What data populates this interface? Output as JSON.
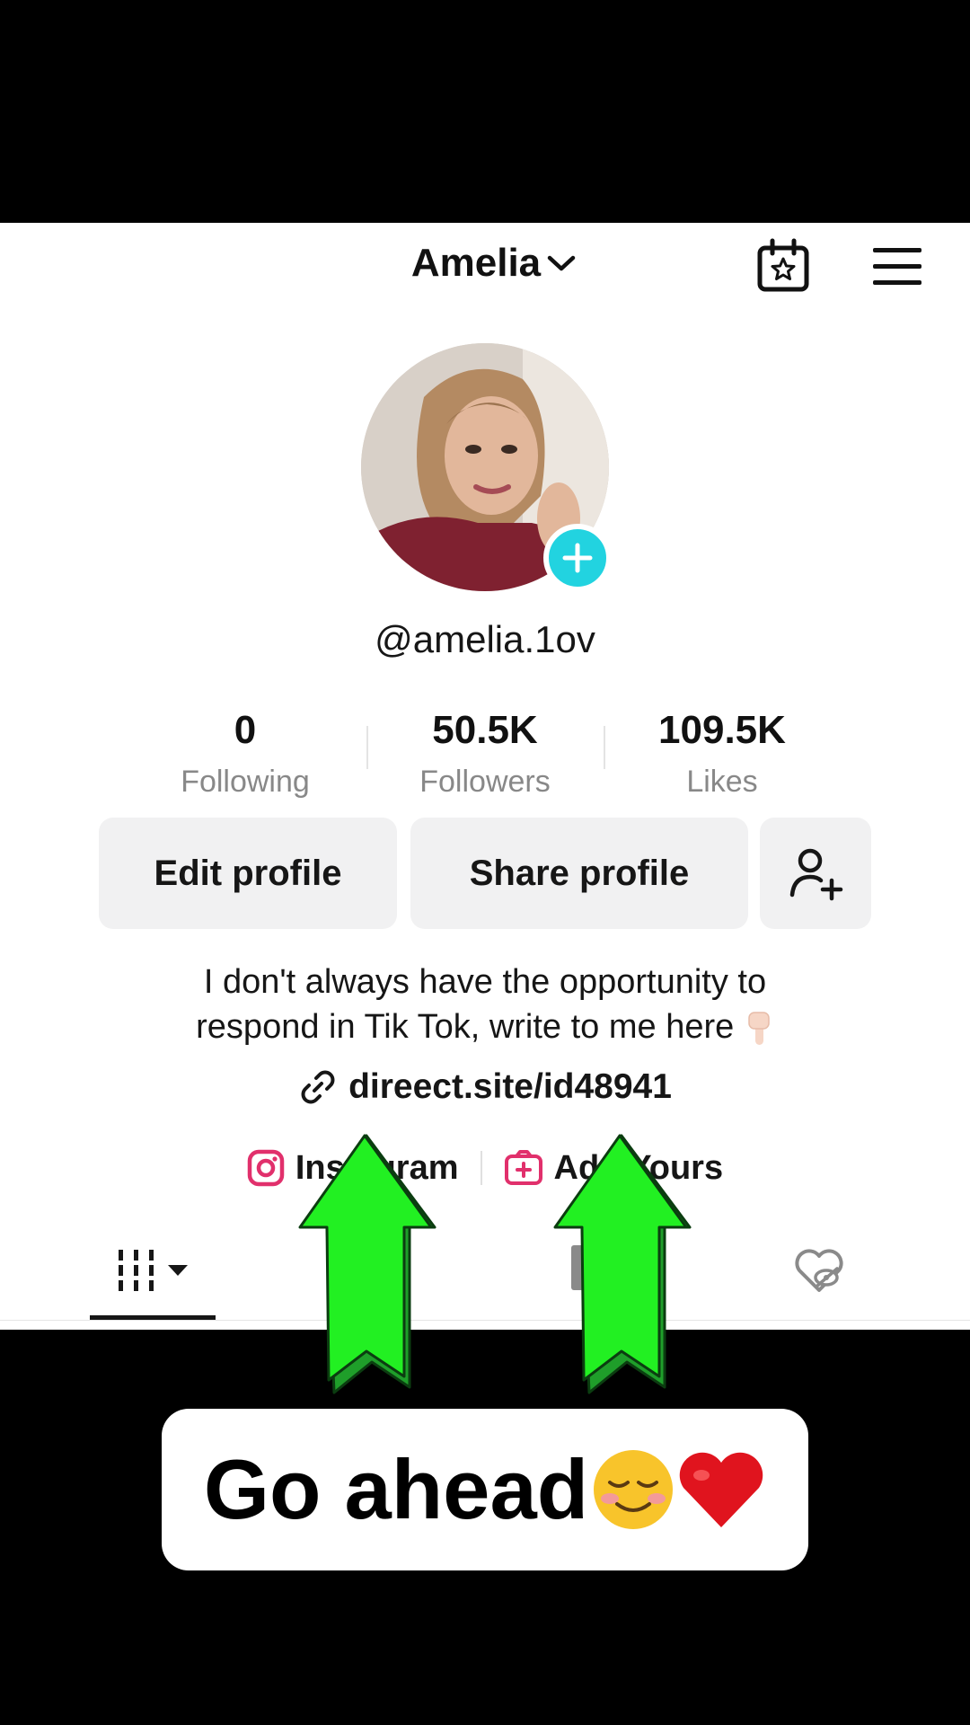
{
  "header": {
    "display_name": "Amelia"
  },
  "profile": {
    "username": "@amelia.1ov",
    "stats": [
      {
        "value": "0",
        "label": "Following"
      },
      {
        "value": "50.5K",
        "label": "Followers"
      },
      {
        "value": "109.5K",
        "label": "Likes"
      }
    ],
    "edit_label": "Edit profile",
    "share_label": "Share profile",
    "bio_line1": "I don't always have the opportunity to",
    "bio_line2": "respond in Tik Tok, write to me here",
    "link": "direect.site/id48941",
    "instagram_label": "Instagram",
    "addyours_label": "Add Yours"
  },
  "caption": {
    "text": "Go ahead"
  },
  "colors": {
    "accent_cyan": "#22d3e0",
    "instagram_pink": "#e1306c",
    "arrow_green": "#22f022"
  }
}
